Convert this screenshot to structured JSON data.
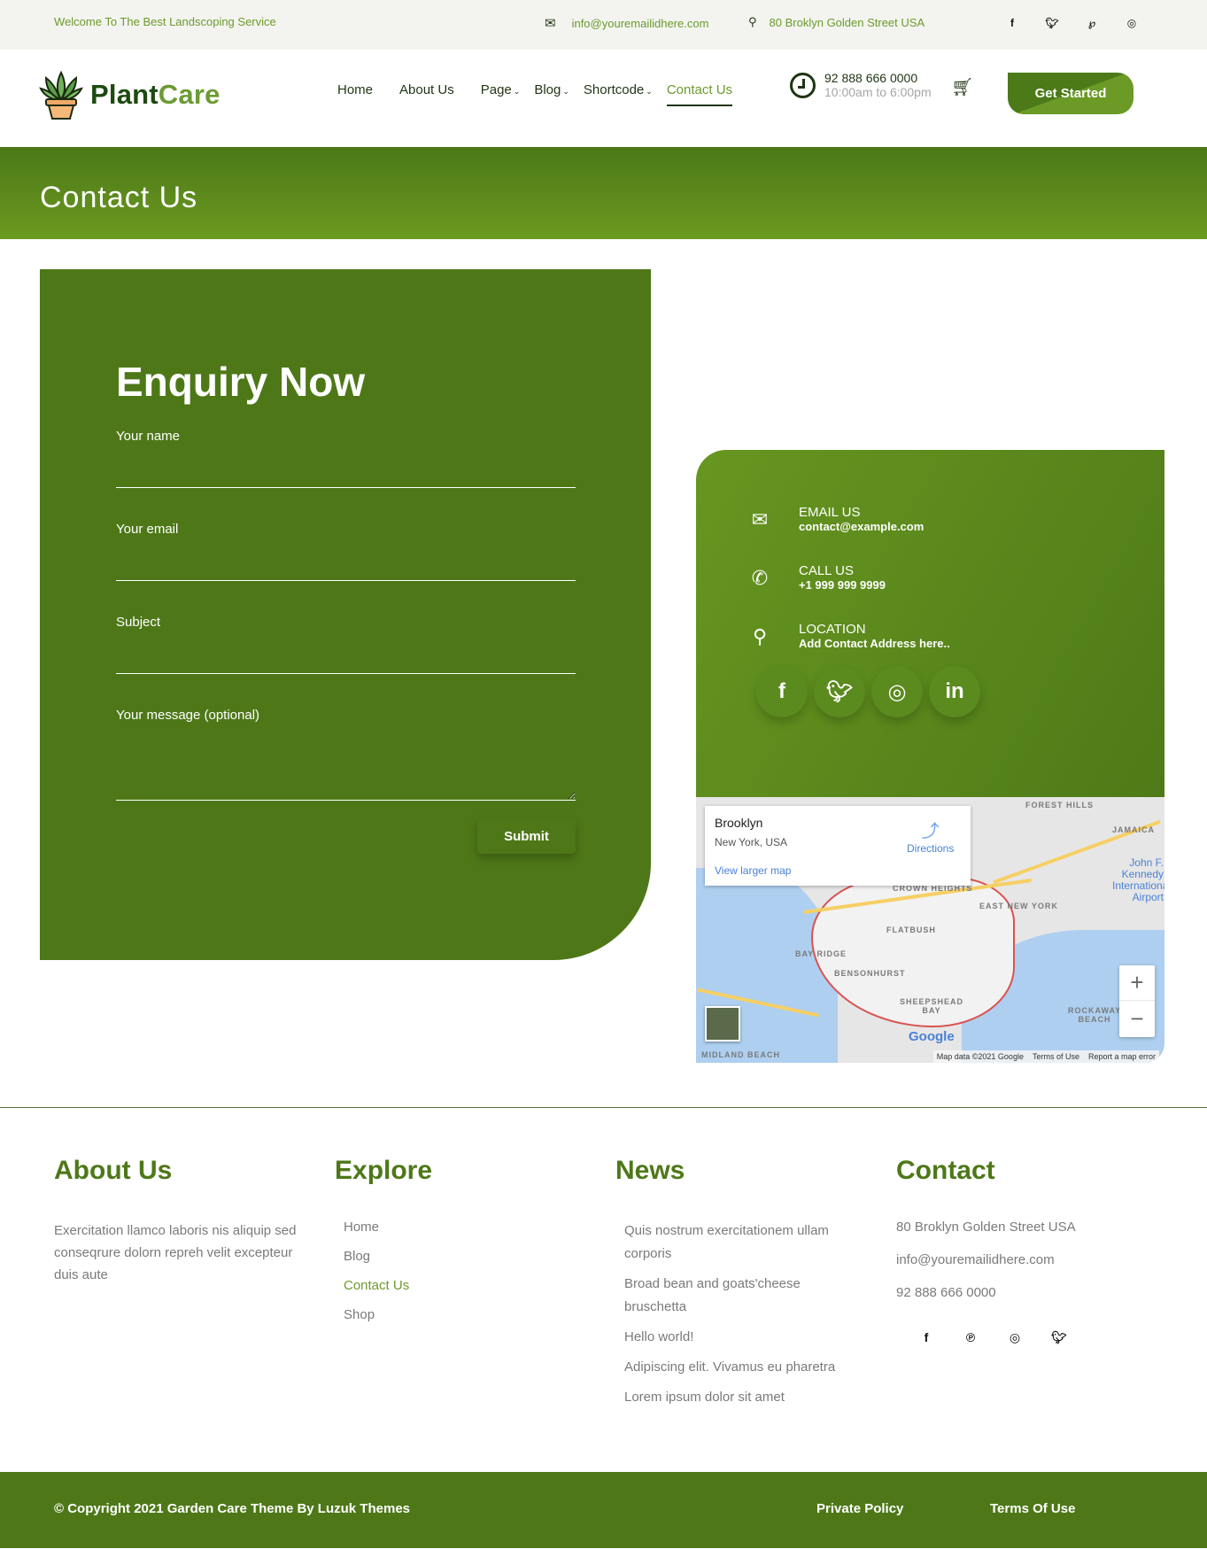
{
  "topbar": {
    "welcome": "Welcome To The Best Landscoping Service",
    "email": "info@youremailidhere.com",
    "address": "80 Broklyn Golden Street USA",
    "social_icons": [
      "facebook-icon",
      "twitter-icon",
      "pinterest-icon",
      "instagram-icon"
    ]
  },
  "header": {
    "logo_part1": "Plant",
    "logo_part2": "Care",
    "nav": [
      {
        "label": "Home",
        "dropdown": false
      },
      {
        "label": "About Us",
        "dropdown": false
      },
      {
        "label": "Page",
        "dropdown": true
      },
      {
        "label": "Blog",
        "dropdown": true
      },
      {
        "label": "Shortcode",
        "dropdown": true
      },
      {
        "label": "Contact Us",
        "dropdown": false,
        "active": true
      }
    ],
    "phone": "92 888 666 0000",
    "hours": "10:00am to 6:00pm",
    "cta": "Get Started"
  },
  "hero": {
    "title": "Contact Us"
  },
  "enquiry": {
    "title": "Enquiry Now",
    "fields": [
      {
        "label": "Your name",
        "value": ""
      },
      {
        "label": "Your email",
        "value": ""
      },
      {
        "label": "Subject",
        "value": ""
      },
      {
        "label": "Your message (optional)",
        "value": ""
      }
    ],
    "submit": "Submit"
  },
  "info": {
    "rows": [
      {
        "icon": "envelope-icon",
        "title": "EMAIL US",
        "value": "contact@example.com"
      },
      {
        "icon": "phone-icon",
        "title": "CALL US",
        "value": "+1 999 999 9999"
      },
      {
        "icon": "location-pin-icon",
        "title": "LOCATION",
        "value": "Add Contact Address here.."
      }
    ],
    "socials": [
      "facebook-icon",
      "twitter-icon",
      "instagram-icon",
      "linkedin-icon"
    ]
  },
  "map": {
    "place": "Brooklyn",
    "subtitle": "New York, USA",
    "directions": "Directions",
    "larger": "View larger map",
    "labels": [
      "FOREST HILLS",
      "JAMAICA",
      "CROWN HEIGHTS",
      "EAST NEW YORK",
      "FLATBUSH",
      "BAY RIDGE",
      "BENSONHURST",
      "SHEEPSHEAD BAY",
      "ROCKAWAY BEACH",
      "MIDLAND BEACH",
      "John F. Kennedy International Airport"
    ],
    "google": "Google",
    "attribution": [
      "Map data ©2021 Google",
      "Terms of Use",
      "Report a map error"
    ]
  },
  "footer": {
    "about": {
      "title": "About Us",
      "text": "Exercitation llamco laboris nis aliquip sed conseqrure dolorn repreh velit excepteur duis aute"
    },
    "explore": {
      "title": "Explore",
      "links": [
        {
          "label": "Home"
        },
        {
          "label": "Blog"
        },
        {
          "label": "Contact Us",
          "active": true
        },
        {
          "label": "Shop"
        }
      ]
    },
    "news": {
      "title": "News",
      "items": [
        "Quis nostrum exercitationem ullam corporis",
        "Broad bean and goats'cheese bruschetta",
        "Hello world!",
        "Adipiscing elit. Vivamus eu pharetra",
        "Lorem ipsum dolor sit amet"
      ]
    },
    "contact": {
      "title": "Contact",
      "address": "80 Broklyn Golden Street USA",
      "email": "info@youremailidhere.com",
      "phone": "92 888 666 0000",
      "socials": [
        "facebook-icon",
        "pinterest-icon",
        "instagram-icon",
        "twitter-icon"
      ]
    }
  },
  "bottombar": {
    "copyright": "© Copyright 2021 Garden Care Theme By Luzuk Themes",
    "privacy": "Private Policy",
    "terms": "Terms Of Use"
  },
  "colors": {
    "primary": "#4e7818",
    "accent": "#6c9a2e",
    "dark": "#1f3512"
  }
}
